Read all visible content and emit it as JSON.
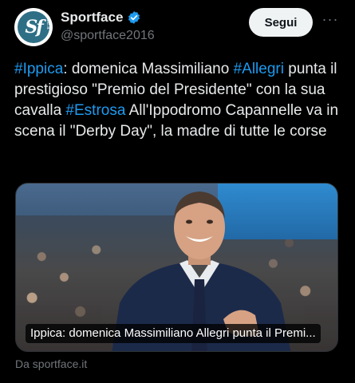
{
  "account": {
    "display_name": "Sportface",
    "handle": "@sportface2016",
    "avatar_text": "Sf",
    "avatar_small": "ace.it"
  },
  "actions": {
    "follow_label": "Segui",
    "more_label": "···"
  },
  "tweet": {
    "segments": [
      {
        "text": "#Ippica",
        "hashtag": true
      },
      {
        "text": ": domenica Massimiliano ",
        "hashtag": false
      },
      {
        "text": "#Allegri",
        "hashtag": true
      },
      {
        "text": " punta il prestigioso \"Premio del Presidente\" con la sua cavalla ",
        "hashtag": false
      },
      {
        "text": "#Estrosa",
        "hashtag": true
      },
      {
        "text": " All'Ippodromo Capannelle va in scena il \"Derby Day\", la madre di tutte le corse",
        "hashtag": false
      }
    ]
  },
  "card": {
    "caption": "Ippica: domenica Massimiliano Allegri punta il Premi...",
    "source": "Da sportface.it"
  },
  "colors": {
    "link": "#1d9bf0",
    "text": "#e7e9ea",
    "muted": "#71767b",
    "background": "#000000",
    "verified": "#1d9bf0"
  },
  "icons": {
    "verified": "verified-badge-icon",
    "more": "more-icon"
  }
}
